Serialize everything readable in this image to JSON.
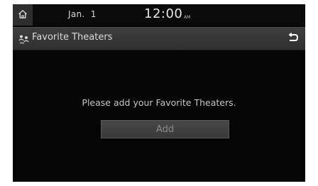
{
  "status_bar": {
    "date": "Jan.  1",
    "time": "12:00",
    "am_pm": "AM"
  },
  "title_bar": {
    "title": "Favorite Theaters"
  },
  "main": {
    "message": "Please add your Favorite Theaters.",
    "add_label": "Add"
  },
  "icons": {
    "home": "home-icon",
    "title": "favorite-theaters-icon",
    "back": "back-icon"
  },
  "colors": {
    "background": "#050505",
    "title_bar": "#363636",
    "home_button": "#2e2e2e",
    "add_button": "#404040"
  }
}
